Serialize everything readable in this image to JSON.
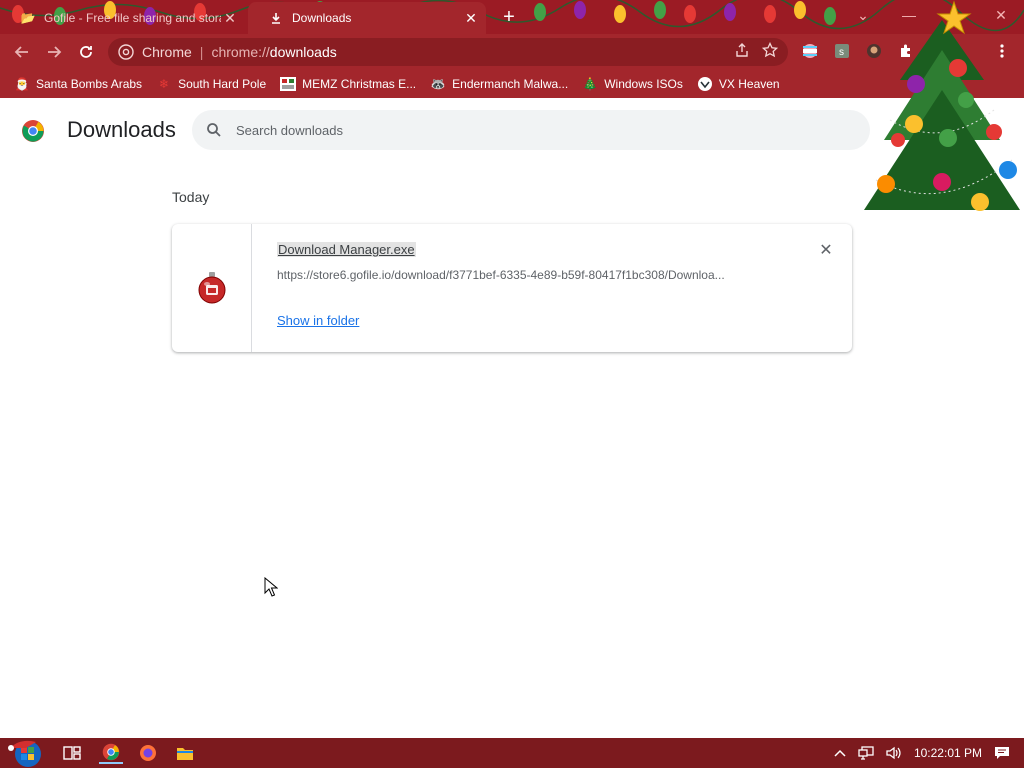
{
  "tabs": [
    {
      "title": "Gofile - Free file sharing and storage",
      "active": false
    },
    {
      "title": "Downloads",
      "active": true
    }
  ],
  "window": {
    "new_tab": "+",
    "minimize": "—",
    "close": "✕",
    "dropdown": "⌄"
  },
  "omnibox": {
    "chip": "Chrome",
    "separator": "|",
    "url_scheme": "chrome://",
    "url_host": "downloads"
  },
  "bookmarks": [
    {
      "label": "Santa Bombs Arabs",
      "icon": "santa-icon"
    },
    {
      "label": "South Hard Pole",
      "icon": "snowflake-icon"
    },
    {
      "label": "MEMZ Christmas E...",
      "icon": "memz-icon"
    },
    {
      "label": "Endermanch Malwa...",
      "icon": "raccoon-icon"
    },
    {
      "label": "Windows ISOs",
      "icon": "tree-icon"
    },
    {
      "label": "VX Heaven",
      "icon": "vx-icon"
    }
  ],
  "header": {
    "title": "Downloads",
    "search_placeholder": "Search downloads"
  },
  "content": {
    "date_heading": "Today",
    "item": {
      "file_name": "Download Manager.exe",
      "url": "https://store6.gofile.io/download/f3771bef-6335-4e89-b59f-80417f1bc308/Downloa...",
      "action": "Show in folder",
      "close": "✕"
    }
  },
  "taskbar": {
    "clock": "10:22:01 PM"
  },
  "colors": {
    "accent_red": "#9b1b24",
    "toolbar_red": "#a3262c",
    "link_blue": "#1a73e8",
    "taskbar": "#7c1a1e"
  }
}
